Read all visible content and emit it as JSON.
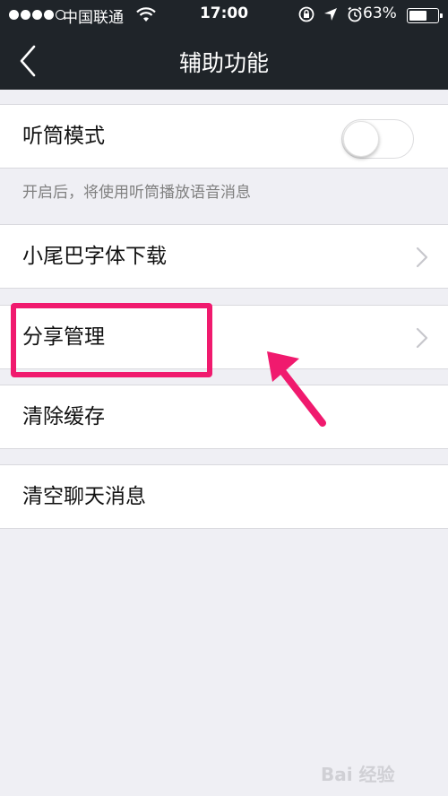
{
  "status_bar": {
    "carrier": "中国联通",
    "time": "17:00",
    "battery_percent": "63%",
    "battery_level": 0.63,
    "signal_filled": 4,
    "signal_total": 5
  },
  "nav": {
    "title": "辅助功能",
    "back_icon": "chevron-left-icon"
  },
  "settings": {
    "earpiece_mode": {
      "label": "听筒模式",
      "enabled": false,
      "footnote": "开启后，将使用听筒播放语音消息"
    },
    "font_download": {
      "label": "小尾巴字体下载"
    },
    "share_management": {
      "label": "分享管理"
    },
    "clear_cache": {
      "label": "清除缓存"
    },
    "clear_chat": {
      "label": "清空聊天消息"
    }
  },
  "annotation": {
    "highlight_color": "#f01a6e",
    "target": "share_management"
  },
  "watermark": {
    "text": "Bai 经验"
  },
  "colors": {
    "nav_background": "#1f2429",
    "page_background": "#efeff4",
    "cell_background": "#ffffff"
  }
}
